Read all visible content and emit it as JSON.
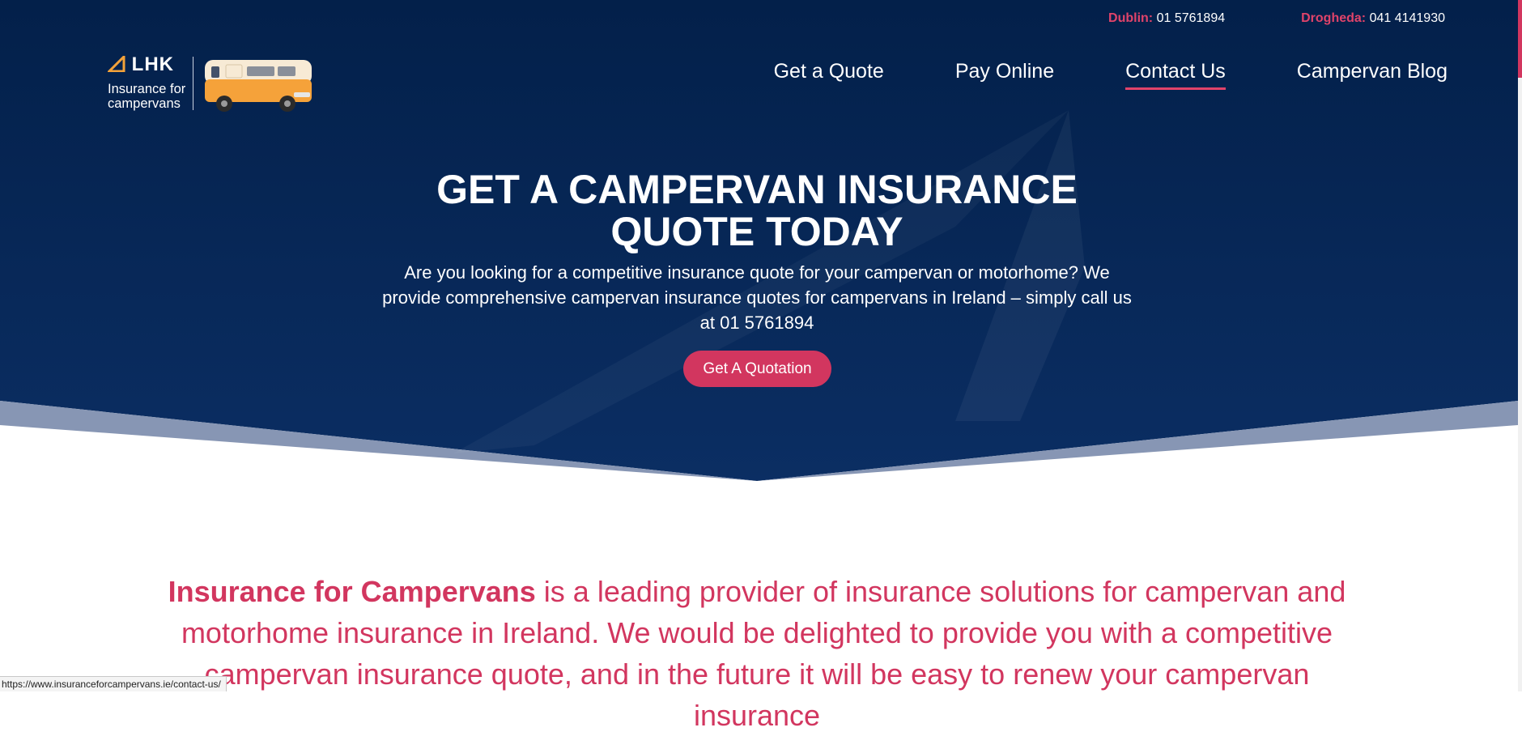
{
  "topbar": {
    "dublin_label": "Dublin:",
    "dublin_phone": "01 5761894",
    "drogheda_label": "Drogheda:",
    "drogheda_phone": "041 4141930"
  },
  "logo": {
    "brand": "LHK",
    "tagline_line1": "Insurance for",
    "tagline_line2": "campervans"
  },
  "nav": {
    "items": [
      {
        "label": "Get a Quote"
      },
      {
        "label": "Pay Online"
      },
      {
        "label": "Contact Us",
        "active": true
      },
      {
        "label": "Campervan Blog"
      }
    ]
  },
  "hero": {
    "title": "GET A CAMPERVAN INSURANCE QUOTE TODAY",
    "subtitle": "Are you looking for a competitive insurance quote for your campervan or motorhome? We provide comprehensive campervan insurance quotes for campervans in Ireland – simply call us at 01 5761894",
    "cta_label": "Get A Quotation"
  },
  "intro": {
    "strong": "Insurance for Campervans",
    "text": " is a leading provider of insurance solutions for campervan and motorhome insurance in Ireland. We would be delighted to provide you with a competitive campervan insurance quote, and in the future it will be easy to renew your campervan insurance"
  },
  "status_url": "https://www.insuranceforcampervans.ie/contact-us/",
  "colors": {
    "navy": "#062552",
    "accent": "#d2365f",
    "band": "#8796b4"
  }
}
